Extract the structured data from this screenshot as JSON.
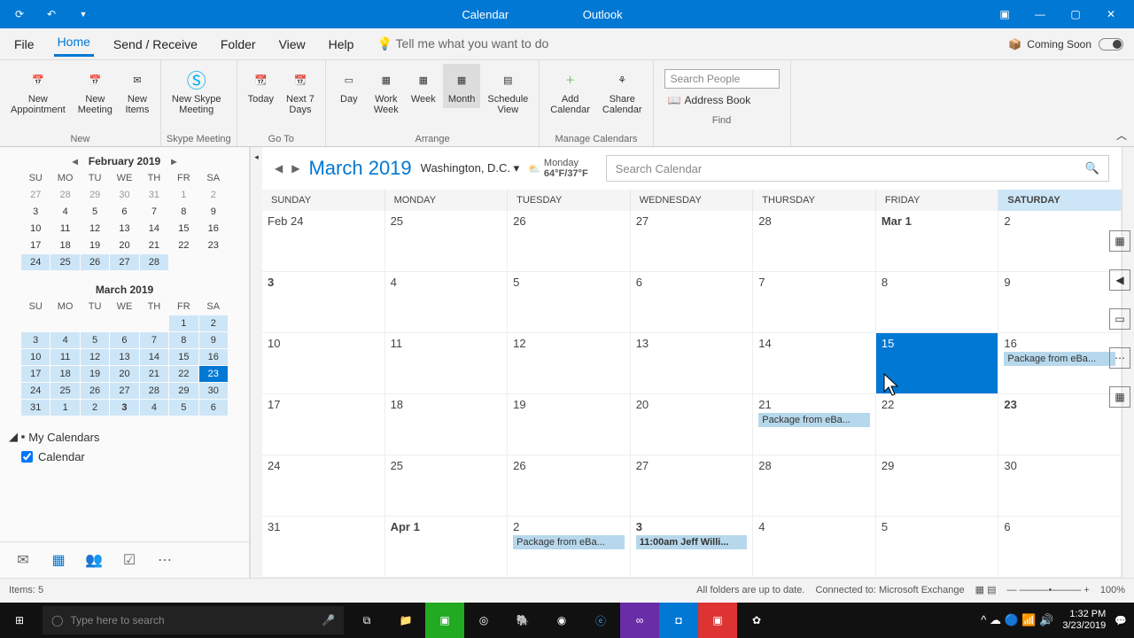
{
  "titlebar": {
    "center_left": "Calendar",
    "center_right": "Outlook"
  },
  "menubar": {
    "items": [
      "File",
      "Home",
      "Send / Receive",
      "Folder",
      "View",
      "Help"
    ],
    "active": 1,
    "tell_me": "Tell me what you want to do",
    "coming_soon": "Coming Soon"
  },
  "ribbon": {
    "new": {
      "label": "New",
      "appointment": "New\nAppointment",
      "meeting": "New\nMeeting",
      "items": "New\nItems"
    },
    "skype": {
      "label": "Skype Meeting",
      "btn": "New Skype\nMeeting"
    },
    "goto": {
      "label": "Go To",
      "today": "Today",
      "next7": "Next 7\nDays"
    },
    "arrange": {
      "label": "Arrange",
      "day": "Day",
      "work": "Work\nWeek",
      "week": "Week",
      "month": "Month",
      "schedule": "Schedule\nView"
    },
    "manage": {
      "label": "Manage Calendars",
      "add": "Add\nCalendar",
      "share": "Share\nCalendar"
    },
    "find": {
      "label": "Find",
      "search_placeholder": "Search People",
      "addr": "Address Book"
    }
  },
  "sidebar": {
    "feb": {
      "title": "February 2019",
      "dh": [
        "SU",
        "MO",
        "TU",
        "WE",
        "TH",
        "FR",
        "SA"
      ],
      "rows": [
        [
          "27",
          "28",
          "29",
          "30",
          "31",
          "1",
          "2"
        ],
        [
          "3",
          "4",
          "5",
          "6",
          "7",
          "8",
          "9"
        ],
        [
          "10",
          "11",
          "12",
          "13",
          "14",
          "15",
          "16"
        ],
        [
          "17",
          "18",
          "19",
          "20",
          "21",
          "22",
          "23"
        ],
        [
          "24",
          "25",
          "26",
          "27",
          "28",
          "",
          ""
        ]
      ]
    },
    "mar": {
      "title": "March 2019",
      "dh": [
        "SU",
        "MO",
        "TU",
        "WE",
        "TH",
        "FR",
        "SA"
      ],
      "rows": [
        [
          "",
          "",
          "",
          "",
          "",
          "1",
          "2"
        ],
        [
          "3",
          "4",
          "5",
          "6",
          "7",
          "8",
          "9"
        ],
        [
          "10",
          "11",
          "12",
          "13",
          "14",
          "15",
          "16"
        ],
        [
          "17",
          "18",
          "19",
          "20",
          "21",
          "22",
          "23"
        ],
        [
          "24",
          "25",
          "26",
          "27",
          "28",
          "29",
          "30"
        ],
        [
          "31",
          "1",
          "2",
          "3",
          "4",
          "5",
          "6"
        ]
      ]
    },
    "list": {
      "header": "My Calendars",
      "item": "Calendar"
    }
  },
  "calendar": {
    "month": "March 2019",
    "location": "Washington,  D.C.",
    "weather_day": "Monday",
    "weather_temp": "64°F/37°F",
    "search_placeholder": "Search Calendar",
    "day_headers": [
      "SUNDAY",
      "MONDAY",
      "TUESDAY",
      "WEDNESDAY",
      "THURSDAY",
      "FRIDAY",
      "SATURDAY"
    ],
    "today_col": 6,
    "cells": [
      [
        "Feb 24",
        "25",
        "26",
        "27",
        "28",
        "Mar 1",
        "2"
      ],
      [
        "3",
        "4",
        "5",
        "6",
        "7",
        "8",
        "9"
      ],
      [
        "10",
        "11",
        "12",
        "13",
        "14",
        "15",
        "16"
      ],
      [
        "17",
        "18",
        "19",
        "20",
        "21",
        "22",
        "23"
      ],
      [
        "24",
        "25",
        "26",
        "27",
        "28",
        "29",
        "30"
      ],
      [
        "31",
        "Apr 1",
        "2",
        "3",
        "4",
        "5",
        "6"
      ]
    ],
    "events": {
      "2_6": "Package from eBa...",
      "3_4": "Package from eBa...",
      "5_2": "Package from eBa...",
      "5_3": "11:00am Jeff Willi..."
    },
    "selected": [
      2,
      5
    ],
    "bold_dates": [
      "Mar 1",
      "23",
      "Apr 1",
      "3"
    ]
  },
  "statusbar": {
    "items": "Items: 5",
    "sync": "All folders are up to date.",
    "conn": "Connected to: Microsoft Exchange",
    "zoom": "100%"
  },
  "taskbar": {
    "search": "Type here to search",
    "time": "1:32 PM",
    "date": "3/23/2019"
  }
}
